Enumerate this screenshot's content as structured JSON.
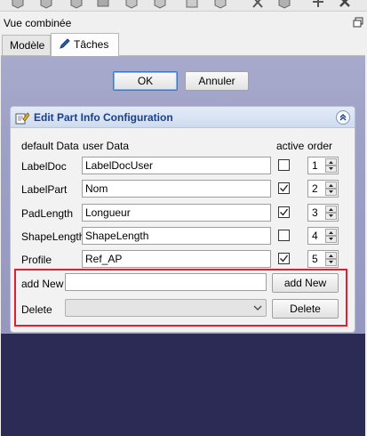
{
  "dock": {
    "title": "Vue combinée"
  },
  "tabs": [
    {
      "label": "Modèle"
    },
    {
      "label": "Tâches"
    }
  ],
  "dialog": {
    "ok_label": "OK",
    "cancel_label": "Annuler"
  },
  "group": {
    "title": "Edit Part Info Configuration"
  },
  "columns": {
    "default_data": "default Data",
    "user_data": "user Data",
    "active": "active",
    "order": "order"
  },
  "rows": [
    {
      "default": "LabelDoc",
      "user": "LabelDocUser",
      "active": false,
      "order": "1"
    },
    {
      "default": "LabelPart",
      "user": "Nom",
      "active": true,
      "order": "2"
    },
    {
      "default": "PadLength",
      "user": "Longueur",
      "active": true,
      "order": "3"
    },
    {
      "default": "ShapeLength",
      "user": "ShapeLength",
      "active": false,
      "order": "4"
    },
    {
      "default": "Profile",
      "user": "Ref_AP",
      "active": true,
      "order": "5"
    }
  ],
  "add_new": {
    "label": "add New",
    "value": "",
    "button_label": "add New"
  },
  "delete": {
    "label": "Delete",
    "selected": "",
    "button_label": "Delete"
  }
}
